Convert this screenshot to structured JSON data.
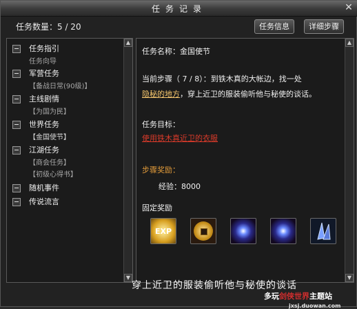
{
  "window": {
    "title": "任务记录",
    "close_glyph": "✕"
  },
  "header": {
    "count_label": "任务数量：5 / 20",
    "buttons": [
      "任务信息",
      "详细步骤"
    ]
  },
  "tree": [
    {
      "label": "任务指引",
      "children": [
        "任务向导"
      ]
    },
    {
      "label": "军营任务",
      "children": [
        "【备战日常(90级)】"
      ]
    },
    {
      "label": "主线剧情",
      "children": [
        "【为国为民】"
      ]
    },
    {
      "label": "世界任务",
      "children": [
        "【金国使节】"
      ]
    },
    {
      "label": "江湖任务",
      "children": [
        "【商会任务】",
        "【初级心得书】"
      ]
    },
    {
      "label": "随机事件",
      "children": []
    },
    {
      "label": "传说流言",
      "children": []
    }
  ],
  "details": {
    "name": "任务名称：金国使节",
    "step_line1": "当前步骤（ 7 / 8）：到铁木真的大帐边，找一处",
    "step_line2_highlight": "隐秘的地方",
    "step_line2_rest": "，穿上近卫的服装偷听他与秘使的谈话。",
    "goal_label": "任务目标：",
    "goal_text": "使用铁木真近卫的衣服",
    "step_reward_label": "步骤奖励：",
    "exp_line": "经验：8000",
    "fixed_reward_label": "固定奖励"
  },
  "rewards": [
    {
      "icon": "exp-scroll-icon",
      "text": "EXP"
    },
    {
      "icon": "coin-icon"
    },
    {
      "icon": "star-orb-icon"
    },
    {
      "icon": "star-orb-icon"
    },
    {
      "icon": "crystal-icon"
    }
  ],
  "overlay": {
    "caption": "穿上近卫的服装偷听他与秘使的谈话",
    "watermark_main": "多玩",
    "watermark_red": "剑侠世界",
    "watermark_tail": "主题站",
    "watermark_site": "jxsj.duowan.com"
  },
  "colors": {
    "highlight_gold": "#f6c66d",
    "goal_red": "#d83a2a",
    "reward_orange": "#e09a3a",
    "tree_child_gray": "#a6a6a6"
  }
}
